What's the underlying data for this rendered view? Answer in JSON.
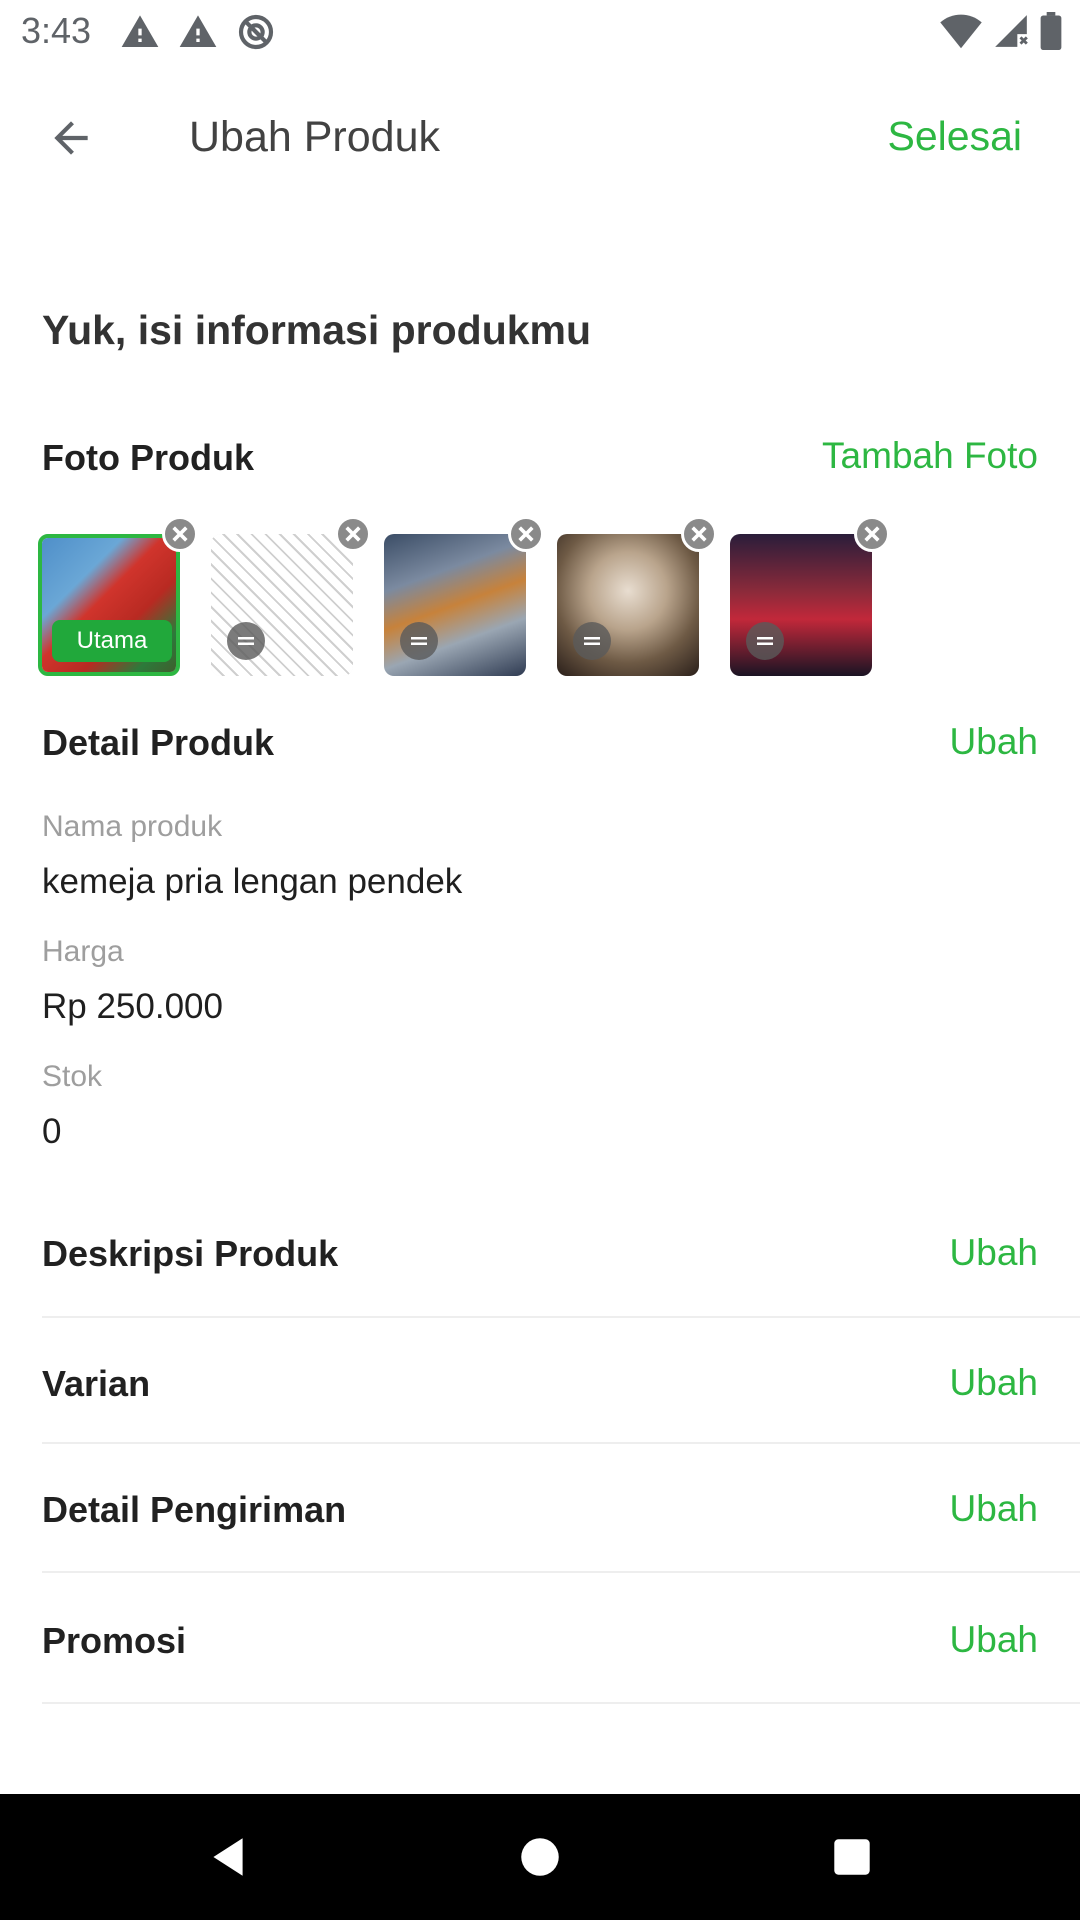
{
  "status_bar": {
    "time": "3:43",
    "icons_left": [
      "alert-icon",
      "alert-icon",
      "data-saver-icon"
    ],
    "icons_right": [
      "wifi-icon",
      "signal-icon",
      "battery-icon"
    ]
  },
  "app_bar": {
    "title": "Ubah Produk",
    "done_label": "Selesai"
  },
  "heading": "Yuk, isi informasi produkmu",
  "photos_section": {
    "title": "Foto Produk",
    "add_label": "Tambah Foto",
    "primary_badge": "Utama",
    "photos": [
      {
        "primary": true
      },
      {
        "primary": false
      },
      {
        "primary": false
      },
      {
        "primary": false
      },
      {
        "primary": false
      }
    ]
  },
  "detail_section": {
    "title": "Detail Produk",
    "action": "Ubah",
    "fields": [
      {
        "label": "Nama produk",
        "value": "kemeja pria lengan pendek"
      },
      {
        "label": "Harga",
        "value": "Rp 250.000"
      },
      {
        "label": "Stok",
        "value": "0"
      }
    ]
  },
  "sections": [
    {
      "title": "Deskripsi Produk",
      "action": "Ubah"
    },
    {
      "title": "Varian",
      "action": "Ubah"
    },
    {
      "title": "Detail Pengiriman",
      "action": "Ubah"
    },
    {
      "title": "Promosi",
      "action": "Ubah"
    }
  ],
  "colors": {
    "accent": "#2db742",
    "badge": "#21a83b",
    "nav_bar": "#000000"
  }
}
